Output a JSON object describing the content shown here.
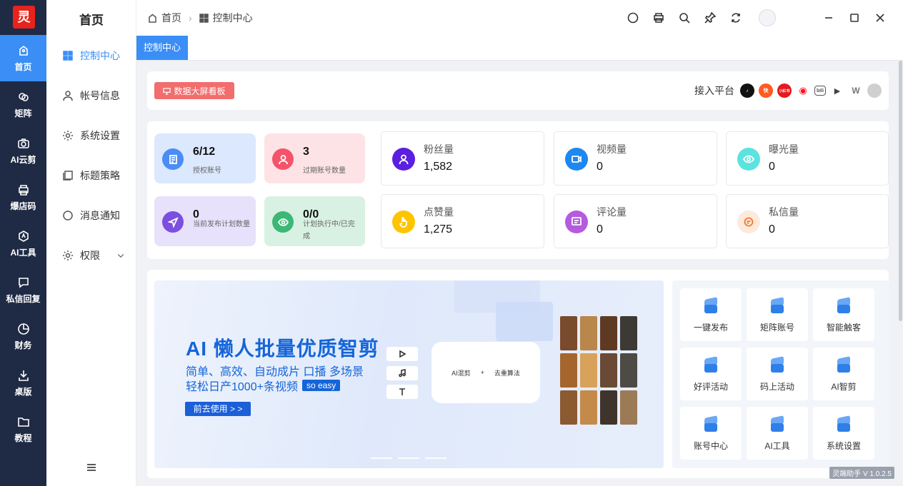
{
  "rail": {
    "logo": "灵",
    "items": [
      {
        "label": "首页",
        "icon": "home-icon"
      },
      {
        "label": "矩阵",
        "icon": "link-icon"
      },
      {
        "label": "AI云剪",
        "icon": "camera-icon"
      },
      {
        "label": "爆店码",
        "icon": "printer-icon"
      },
      {
        "label": "AI工具",
        "icon": "ai-tool-icon"
      },
      {
        "label": "私信回复",
        "icon": "chat-icon"
      },
      {
        "label": "财务",
        "icon": "pie-icon"
      },
      {
        "label": "桌版",
        "icon": "download-icon"
      },
      {
        "label": "教程",
        "icon": "folder-icon"
      }
    ]
  },
  "subnav": {
    "title": "首页",
    "items": [
      {
        "label": "控制中心"
      },
      {
        "label": "帐号信息"
      },
      {
        "label": "系统设置"
      },
      {
        "label": "标题策略"
      },
      {
        "label": "消息通知"
      },
      {
        "label": "权限"
      }
    ]
  },
  "breadcrumb": {
    "home": "首页",
    "current": "控制中心"
  },
  "tabs": {
    "active": "控制中心"
  },
  "header": {
    "screen_button": "数据大屏看板",
    "platform_label": "接入平台",
    "platforms": [
      {
        "name": "douyin",
        "color": "#111111",
        "text": "♪"
      },
      {
        "name": "kuaishou",
        "color": "#ff5a1f",
        "text": "快"
      },
      {
        "name": "xiaohongshu",
        "color": "#ff2442",
        "text": "小红书"
      },
      {
        "name": "toutiao",
        "color": "#ffffff",
        "text": "◉"
      },
      {
        "name": "bilibili",
        "color": "#ffffff",
        "text": "bili"
      },
      {
        "name": "video",
        "color": "#ffffff",
        "text": "▶"
      },
      {
        "name": "wechat-channels",
        "color": "#ffffff",
        "text": "W"
      },
      {
        "name": "more",
        "color": "#cfcfcf",
        "text": ""
      }
    ]
  },
  "mini_cards": [
    {
      "value": "6/12",
      "label": "授权账号",
      "bg": "#dbe8fd",
      "icon_bg": "#4a8df6"
    },
    {
      "value": "3",
      "label": "过期账号数量",
      "bg": "#fde3e6",
      "icon_bg": "#f5536a"
    },
    {
      "value": "0",
      "label": "当前发布计划数量",
      "bg": "#e8e1fb",
      "icon_bg": "#7b4fe0"
    },
    {
      "value": "0/0",
      "label": "计划执行中/已完成",
      "bg": "#d9f1e3",
      "icon_bg": "#3cb876"
    }
  ],
  "stats": [
    {
      "label": "粉丝量",
      "value": "1,582",
      "color": "#5b1fe0"
    },
    {
      "label": "视频量",
      "value": "0",
      "color": "#1e87f0"
    },
    {
      "label": "曝光量",
      "value": "0",
      "color": "#5ce3dd"
    },
    {
      "label": "点赞量",
      "value": "1,275",
      "color": "#ffc400"
    },
    {
      "label": "评论量",
      "value": "0",
      "color": "#b45be0"
    },
    {
      "label": "私信量",
      "value": "0",
      "color": "#fde3cf"
    }
  ],
  "banner": {
    "title": "AI 懒人批量优质智剪",
    "line1": "简单、高效、自动成片 口播 多场景",
    "line2": "轻松日产1000+条视频",
    "tag": "so easy",
    "button": "前去使用 > >",
    "card_left": "AI混剪",
    "card_plus": "+",
    "card_right": "去重算法"
  },
  "quick": [
    {
      "label": "一键发布"
    },
    {
      "label": "矩阵账号"
    },
    {
      "label": "智能触客"
    },
    {
      "label": "好评活动"
    },
    {
      "label": "码上活动"
    },
    {
      "label": "AI智剪"
    },
    {
      "label": "账号中心"
    },
    {
      "label": "AI工具"
    },
    {
      "label": "系统设置"
    }
  ],
  "version": "灵端助手 V 1.0.2.5"
}
